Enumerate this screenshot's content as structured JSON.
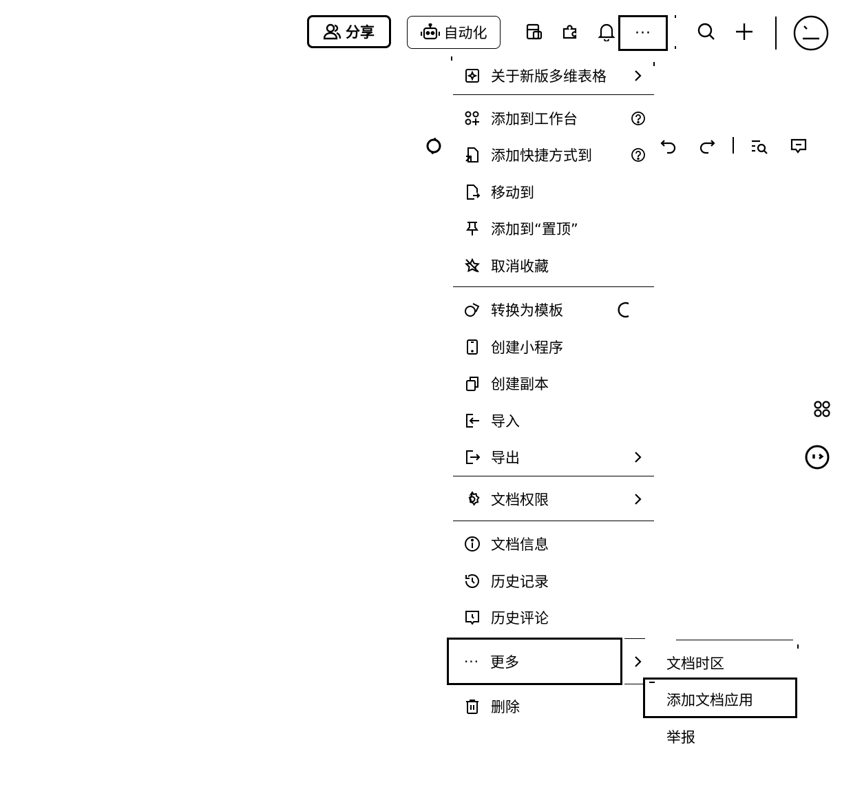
{
  "toolbar": {
    "share_label": "分享",
    "automation_label": "自动化",
    "more_label": "···",
    "icons": [
      "table-icon",
      "plugin-icon",
      "bell-icon",
      "more-icon",
      "search-icon",
      "plus-icon",
      "avatar"
    ]
  },
  "secondary_toolbar": {
    "icons": [
      "sync-icon",
      "undo-icon",
      "redo-icon",
      "find-icon",
      "comment-icon"
    ]
  },
  "menu": {
    "groups": [
      [
        {
          "label": "关于新版多维表格",
          "icon": "new-version-icon",
          "submenu": true
        }
      ],
      [
        {
          "label": "添加到工作台",
          "icon": "workbench-icon",
          "help": true
        },
        {
          "label": "添加快捷方式到",
          "icon": "shortcut-icon",
          "help": true
        },
        {
          "label": "移动到",
          "icon": "move-icon"
        },
        {
          "label": "添加到“置顶”",
          "icon": "pin-icon"
        },
        {
          "label": "取消收藏",
          "icon": "unstar-icon"
        }
      ],
      [
        {
          "label": "转换为模板",
          "icon": "template-icon",
          "loading": true
        },
        {
          "label": "创建小程序",
          "icon": "mobile-icon"
        },
        {
          "label": "创建副本",
          "icon": "copy-icon"
        },
        {
          "label": "导入",
          "icon": "import-icon"
        },
        {
          "label": "导出",
          "icon": "export-icon",
          "submenu": true
        }
      ],
      [
        {
          "label": "文档权限",
          "icon": "gear-icon",
          "submenu": true
        }
      ],
      [
        {
          "label": "文档信息",
          "icon": "info-icon"
        },
        {
          "label": "历史记录",
          "icon": "history-icon"
        },
        {
          "label": "历史评论",
          "icon": "comment-history-icon"
        },
        {
          "label": "更多",
          "icon": "ellipsis-icon",
          "submenu": true,
          "highlighted": true
        },
        {
          "label": "删除",
          "icon": "trash-icon"
        }
      ]
    ],
    "more_icon_glyph": "···"
  },
  "submenu": {
    "items": [
      {
        "label": "文档时区"
      },
      {
        "label": "添加文档应用",
        "highlighted": true
      },
      {
        "label": "举报"
      }
    ]
  },
  "sidebar_right": {
    "icons": [
      "apps-icon",
      "assistant-icon"
    ]
  }
}
